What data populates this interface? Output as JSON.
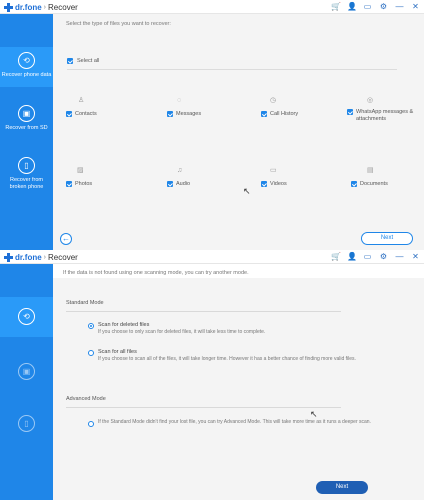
{
  "app": {
    "brand": "dr.fone",
    "separator": "›",
    "title": "Recover"
  },
  "title_icons": [
    "cart-icon",
    "user-icon",
    "feedback-icon",
    "settings-icon",
    "minimize-icon",
    "close-icon"
  ],
  "sidebar": {
    "items": [
      {
        "label": "Recover phone data",
        "icon": "phone-recover-icon"
      },
      {
        "label": "Recover from SD",
        "icon": "sd-card-icon"
      },
      {
        "label": "Recover from broken phone",
        "icon": "broken-phone-icon"
      }
    ]
  },
  "select_screen": {
    "hint": "Select the type of files you want to recover:",
    "select_all": "Select all",
    "file_types": [
      {
        "label": "Contacts",
        "icon": "contacts-icon"
      },
      {
        "label": "Messages",
        "icon": "messages-icon"
      },
      {
        "label": "Call History",
        "icon": "call-history-icon"
      },
      {
        "label": "WhatsApp messages & attachments",
        "icon": "whatsapp-icon"
      },
      {
        "label": "Photos",
        "icon": "photos-icon"
      },
      {
        "label": "Audio",
        "icon": "audio-icon"
      },
      {
        "label": "Videos",
        "icon": "videos-icon"
      },
      {
        "label": "Documents",
        "icon": "documents-icon"
      }
    ],
    "next": "Next"
  },
  "mode_screen": {
    "subtitle": "If the data is not found using one scanning mode, you can try another mode.",
    "standard_mode": "Standard Mode",
    "scan_deleted_title": "Scan for deleted files",
    "scan_deleted_desc": "If you choose to only scan for deleted files, it will take less time to complete.",
    "scan_all_title": "Scan for all files",
    "scan_all_desc": "If you choose to scan all of the files, it will take longer time. However it has a better chance of finding more valid files.",
    "advanced_mode": "Advanced Mode",
    "advanced_desc": "If the Standard Mode didn't find your lost file, you can try Advanced Mode. This will take more time as it runs a deeper scan.",
    "next": "Next"
  },
  "colors": {
    "accent": "#1f86e8",
    "sidebar": "#1f86e8",
    "cart": "#f29100",
    "next_solid": "#1f5fb4"
  }
}
